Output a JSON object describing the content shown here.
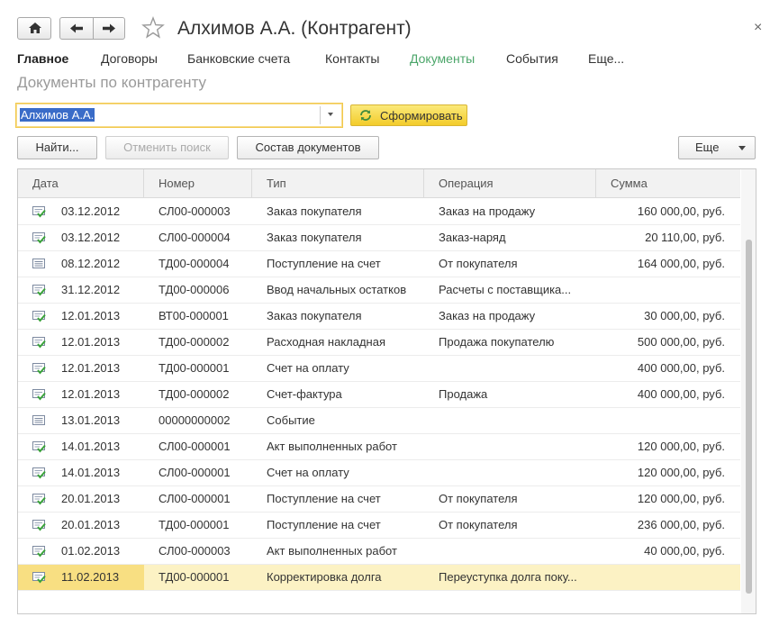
{
  "window": {
    "title": "Алхимов А.А. (Контрагент)",
    "close": "×"
  },
  "tabs": [
    {
      "label": "Главное"
    },
    {
      "label": "Договоры"
    },
    {
      "label": "Банковские счета"
    },
    {
      "label": "Контакты"
    },
    {
      "label": "Документы"
    },
    {
      "label": "События"
    },
    {
      "label": "Еще..."
    }
  ],
  "page": {
    "subtitle": "Документы по контрагенту"
  },
  "filter": {
    "counterparty_value": "Алхимов А.А.",
    "generate_label": "Сформировать"
  },
  "toolbar": {
    "find_label": "Найти...",
    "cancel_search_label": "Отменить поиск",
    "doc_composition_label": "Состав документов",
    "more_label": "Еще"
  },
  "table": {
    "columns": [
      "Дата",
      "Номер",
      "Тип",
      "Операция",
      "Сумма"
    ],
    "rows": [
      {
        "icon": "posted-document-icon",
        "date": "03.12.2012",
        "number": "СЛ00-000003",
        "type": "Заказ покупателя",
        "operation": "Заказ на продажу",
        "sum": "160 000,00, руб."
      },
      {
        "icon": "posted-document-icon",
        "date": "03.12.2012",
        "number": "СЛ00-000004",
        "type": "Заказ покупателя",
        "operation": "Заказ-наряд",
        "sum": "20 110,00, руб."
      },
      {
        "icon": "document-icon",
        "date": "08.12.2012",
        "number": "ТД00-000004",
        "type": "Поступление на счет",
        "operation": "От покупателя",
        "sum": "164 000,00, руб."
      },
      {
        "icon": "posted-document-icon",
        "date": "31.12.2012",
        "number": "ТД00-000006",
        "type": "Ввод начальных остатков",
        "operation": "Расчеты с поставщика...",
        "sum": ""
      },
      {
        "icon": "posted-document-icon",
        "date": "12.01.2013",
        "number": "ВТ00-000001",
        "type": "Заказ покупателя",
        "operation": "Заказ на продажу",
        "sum": "30 000,00, руб."
      },
      {
        "icon": "posted-document-icon",
        "date": "12.01.2013",
        "number": "ТД00-000002",
        "type": "Расходная накладная",
        "operation": "Продажа покупателю",
        "sum": "500 000,00, руб."
      },
      {
        "icon": "posted-document-icon",
        "date": "12.01.2013",
        "number": "ТД00-000001",
        "type": "Счет на оплату",
        "operation": "",
        "sum": "400 000,00, руб."
      },
      {
        "icon": "posted-document-icon",
        "date": "12.01.2013",
        "number": "ТД00-000002",
        "type": "Счет-фактура",
        "operation": "Продажа",
        "sum": "400 000,00, руб."
      },
      {
        "icon": "document-icon",
        "date": "13.01.2013",
        "number": "00000000002",
        "type": "Событие",
        "operation": "",
        "sum": ""
      },
      {
        "icon": "posted-document-icon",
        "date": "14.01.2013",
        "number": "СЛ00-000001",
        "type": "Акт выполненных работ",
        "operation": "",
        "sum": "120 000,00, руб."
      },
      {
        "icon": "posted-document-icon",
        "date": "14.01.2013",
        "number": "СЛ00-000001",
        "type": "Счет на оплату",
        "operation": "",
        "sum": "120 000,00, руб."
      },
      {
        "icon": "posted-document-icon",
        "date": "20.01.2013",
        "number": "СЛ00-000001",
        "type": "Поступление на счет",
        "operation": "От покупателя",
        "sum": "120 000,00, руб."
      },
      {
        "icon": "posted-document-icon",
        "date": "20.01.2013",
        "number": "ТД00-000001",
        "type": "Поступление на счет",
        "operation": "От покупателя",
        "sum": "236 000,00, руб."
      },
      {
        "icon": "posted-document-icon",
        "date": "01.02.2013",
        "number": "СЛ00-000003",
        "type": "Акт выполненных работ",
        "operation": "",
        "sum": "40 000,00, руб."
      },
      {
        "icon": "posted-document-icon",
        "date": "11.02.2013",
        "number": "ТД00-000001",
        "type": "Корректировка долга",
        "operation": "Переуступка долга поку...",
        "sum": "",
        "selected": true
      }
    ]
  },
  "colors": {
    "accent_green": "#4ca66a",
    "selection": "#fcf2c4",
    "selected_cell": "#f8df82",
    "generate_button": "#f3cc2a",
    "focus_border": "#f2c94c"
  }
}
